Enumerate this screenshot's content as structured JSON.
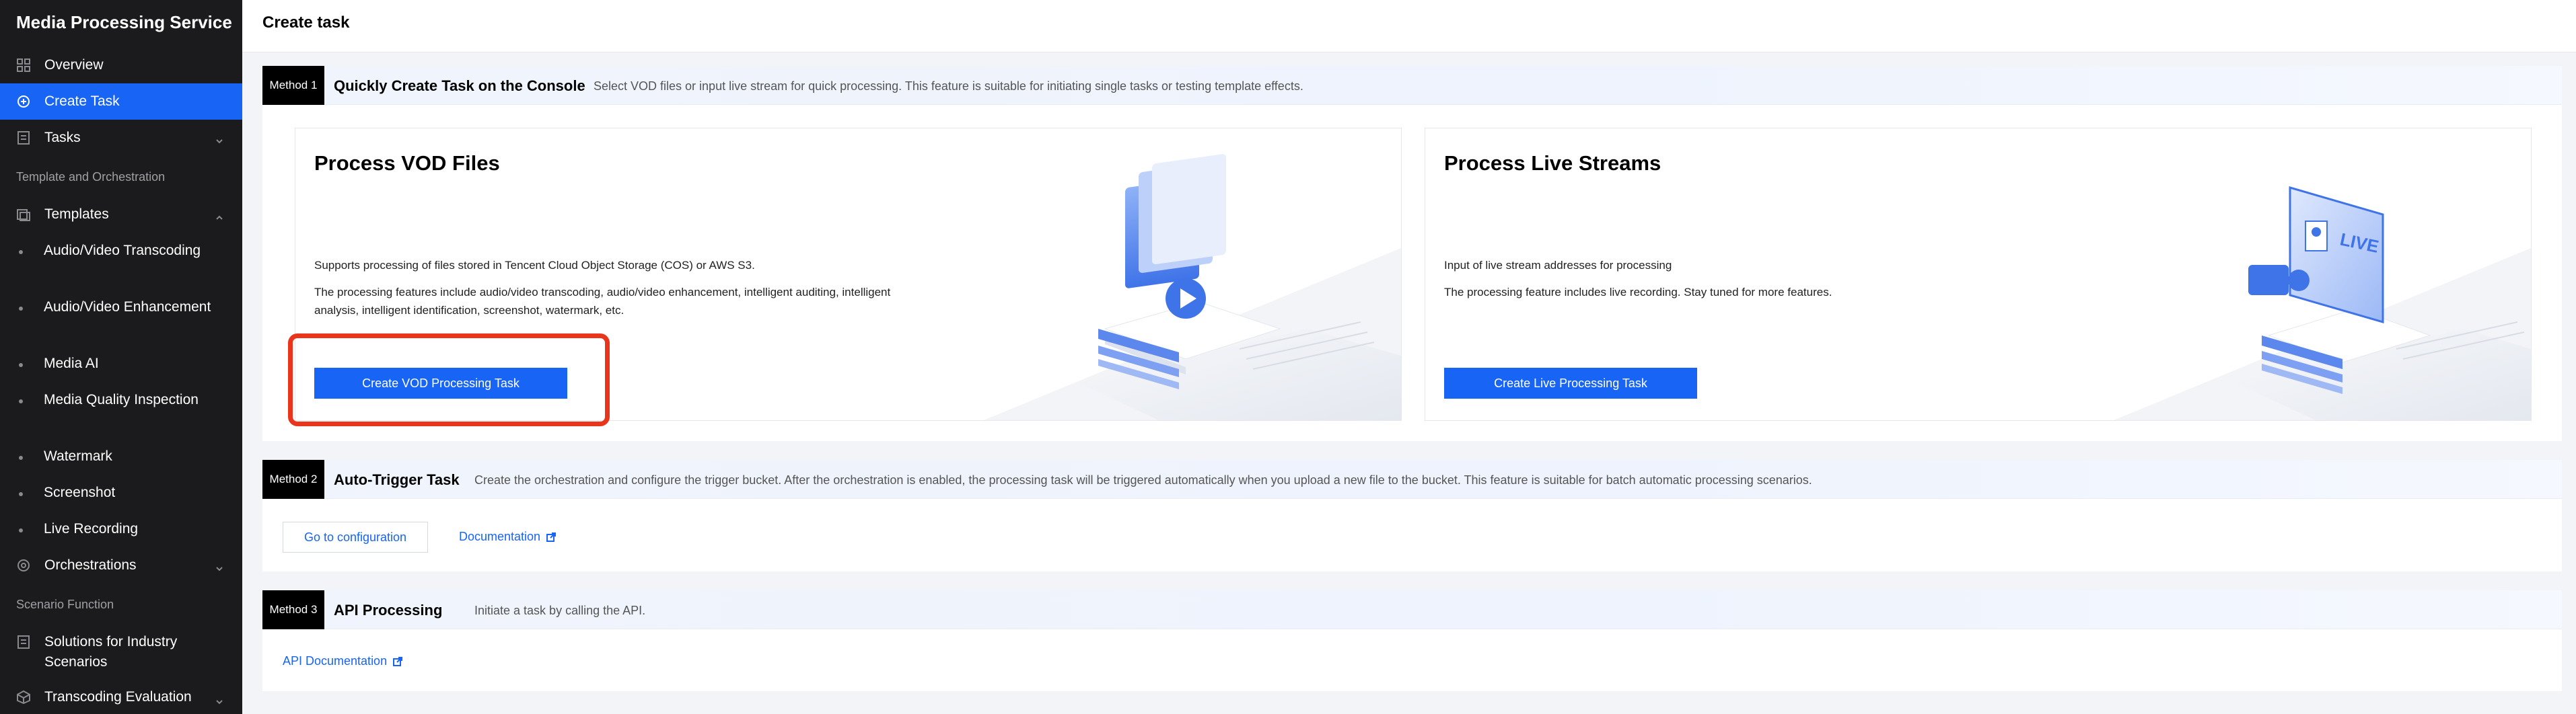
{
  "sidebar": {
    "title": "Media Processing Service",
    "items": {
      "overview": "Overview",
      "create_task": "Create Task",
      "tasks": "Tasks",
      "templates": "Templates",
      "orchestrations": "Orchestrations",
      "solutions": "Solutions for Industry Scenarios",
      "transcoding_eval": "Transcoding Evaluation"
    },
    "groups": {
      "template_orchestration": "Template and Orchestration",
      "scenario_function": "Scenario Function"
    },
    "template_subitems": [
      "Audio/Video Transcoding",
      "Audio/Video Enhancement",
      "Media AI",
      "Media Quality Inspection",
      "Watermark",
      "Screenshot",
      "Live Recording"
    ]
  },
  "header": {
    "title": "Create task"
  },
  "method1": {
    "tag": "Method 1",
    "title": "Quickly Create Task on the Console",
    "description": "Select VOD files or input live stream for quick processing. This feature is suitable for initiating single tasks or testing template effects.",
    "vod_card": {
      "title": "Process VOD Files",
      "line1": "Supports processing of files stored in Tencent Cloud Object Storage (COS) or AWS S3.",
      "line2": "The processing features include audio/video transcoding, audio/video enhancement, intelligent auditing, intelligent analysis, intelligent identification, screenshot, watermark, etc.",
      "button": "Create VOD Processing Task"
    },
    "live_card": {
      "title": "Process Live Streams",
      "line1": "Input of live stream addresses for processing",
      "line2": "The processing feature includes live recording. Stay tuned for more features.",
      "button": "Create Live Processing Task",
      "art_label": "LIVE"
    }
  },
  "method2": {
    "tag": "Method 2",
    "title": "Auto-Trigger Task",
    "description": "Create the orchestration and configure the trigger bucket. After the orchestration is enabled, the processing task will be triggered automatically when you upload a new file to the bucket. This feature is suitable for batch automatic processing scenarios.",
    "config_button": "Go to configuration",
    "doc_link": "Documentation"
  },
  "method3": {
    "tag": "Method 3",
    "title": "API Processing",
    "description": "Initiate a task by calling the API.",
    "doc_link": "API Documentation"
  },
  "colors": {
    "accent": "#1764f5",
    "sidebar_bg": "#1b1b1d",
    "highlight": "#e8351c"
  }
}
